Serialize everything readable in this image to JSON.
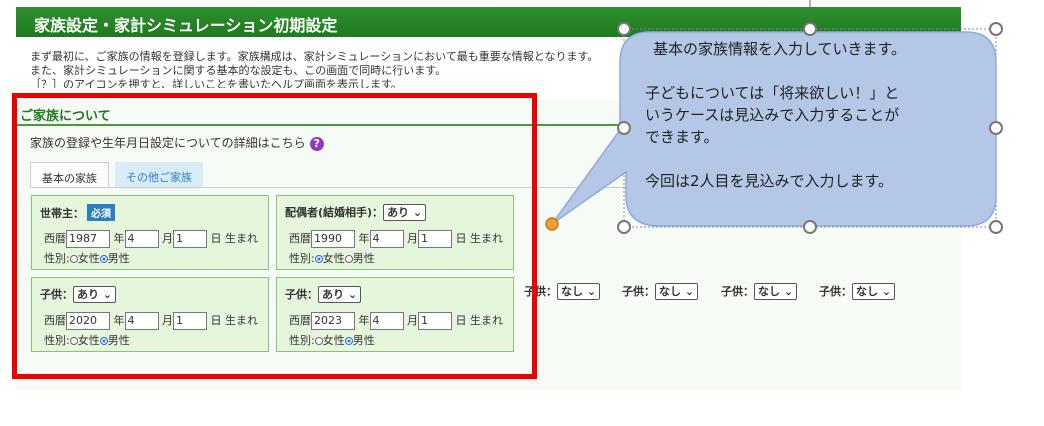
{
  "header": {
    "title": "家族設定・家計シミュレーション初期設定"
  },
  "intro": {
    "line1": "まず最初に、ご家族の情報を登録します。家族構成は、家計シミュレーションにおいて最も重要な情報となります。",
    "line2": "また、家計シミュレーションに関する基本的な設定も、この画面で同時に行います。",
    "line3": "［？］のアイコンを押すと、詳しいことを書いたヘルプ画面を表示します。"
  },
  "section": {
    "title": "ご家族について",
    "detail": "家族の登録や生年月日設定についての詳細はこちら",
    "help_icon": "?"
  },
  "tabs": [
    {
      "label": "基本の家族"
    },
    {
      "label": "その他ご家族"
    }
  ],
  "labels": {
    "era": "西暦",
    "year": "年",
    "month": "月",
    "day": "日 生まれ",
    "gender": "性別:",
    "female": "女性",
    "male": "男性"
  },
  "cards": [
    {
      "role": "世帯主：",
      "badge": "必須",
      "year": "1987",
      "month": "4",
      "day": "1",
      "gender": "male"
    },
    {
      "role": "配偶者(結婚相手)：",
      "select": "あり",
      "year": "1990",
      "month": "4",
      "day": "1",
      "gender": "female"
    },
    {
      "role": "子供：",
      "select": "あり",
      "year": "2020",
      "month": "4",
      "day": "1",
      "gender": "male"
    },
    {
      "role": "子供：",
      "select": "あり",
      "year": "2023",
      "month": "4",
      "day": "1",
      "gender": "male"
    }
  ],
  "extra_children": [
    {
      "label": "子供：",
      "select": "なし"
    },
    {
      "label": "子供：",
      "select": "なし"
    },
    {
      "label": "子供：",
      "select": "なし"
    },
    {
      "label": "子供：",
      "select": "なし"
    }
  ],
  "callout": {
    "line1": "基本の家族情報を入力していきます。",
    "line2": "子どもについては「将来欲しい！」と",
    "line3": "いうケースは見込みで入力することが",
    "line4": "できます。",
    "line5": "今回は2人目を見込みで入力します。"
  },
  "colors": {
    "header": "#1f7a1f",
    "card": "#e6f6dc",
    "callout": "#b4c7e7",
    "highlight": "#ee0000"
  }
}
